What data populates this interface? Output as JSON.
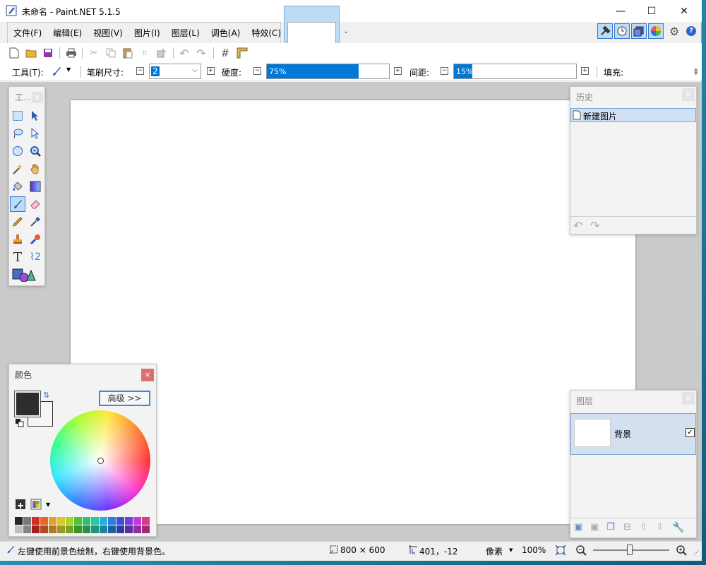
{
  "window": {
    "title": "未命名 - Paint.NET 5.1.5",
    "minimize": "—",
    "maximize": "☐",
    "close": "✕"
  },
  "menu": [
    {
      "label": "文件(F)"
    },
    {
      "label": "编辑(E)"
    },
    {
      "label": "视图(V)"
    },
    {
      "label": "图片(I)"
    },
    {
      "label": "图层(L)"
    },
    {
      "label": "调色(A)"
    },
    {
      "label": "特效(C)"
    }
  ],
  "toolbar": {
    "tool_label": "工具(T):",
    "brush_size_label": "笔刷尺寸:",
    "brush_size_value": "2",
    "hardness_label": "硬度:",
    "hardness_value": "75%",
    "hardness_fraction": 0.75,
    "spacing_label": "间距:",
    "spacing_value": "15%",
    "spacing_fraction": 0.15,
    "fill_label": "填充:"
  },
  "tools_panel": {
    "title": "工..."
  },
  "history_panel": {
    "title": "历史",
    "items": [
      {
        "label": "新建图片"
      }
    ]
  },
  "layers_panel": {
    "title": "图层",
    "layers": [
      {
        "name": "背景",
        "visible": true
      }
    ]
  },
  "colors_panel": {
    "title": "颜色",
    "advanced_button": "高级 >>",
    "primary_color": "#2d2d2d",
    "secondary_color": "#f5f5f5",
    "palette": [
      "#252525",
      "#777777",
      "#d42b2b",
      "#e8662a",
      "#e8a22a",
      "#d8c92a",
      "#a6d62a",
      "#4fc43a",
      "#2ac46a",
      "#2ac4a6",
      "#2aaed8",
      "#2a7ed8",
      "#3a4ed8",
      "#7a3ad8",
      "#c43ad8",
      "#d83a8e"
    ]
  },
  "statusbar": {
    "hint": "左键使用前景色绘制，右键使用背景色。",
    "image_size": "800 × 600",
    "cursor_pos": "401，-12",
    "units": "像素",
    "zoom": "100%"
  }
}
